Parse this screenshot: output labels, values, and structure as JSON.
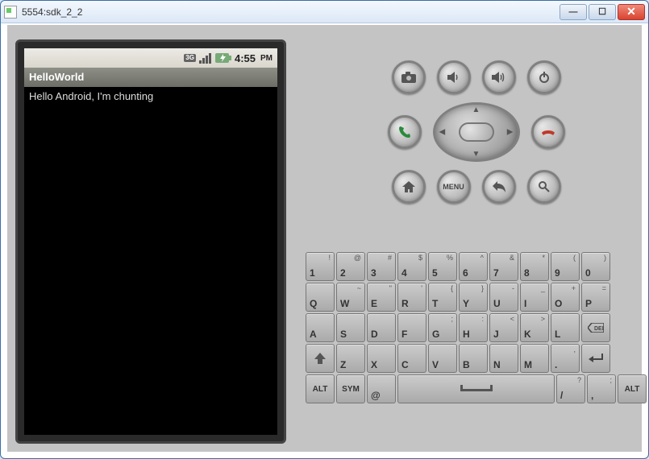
{
  "window": {
    "title": "5554:sdk_2_2"
  },
  "winbtns": {
    "min": "—",
    "max": "☐",
    "close": "✕"
  },
  "statusbar": {
    "threeg_top": "3G",
    "threeg_bot": "↑↓",
    "time": "4:55",
    "ampm": "PM"
  },
  "app": {
    "title": "HelloWorld",
    "body": "Hello Android, I'm chunting"
  },
  "hw": {
    "camera": "camera",
    "voldown": "vol-down",
    "volup": "vol-up",
    "power": "power",
    "call": "call",
    "end": "end-call",
    "home": "home",
    "menu": "MENU",
    "back": "back",
    "search": "search"
  },
  "kb": {
    "row1": [
      {
        "m": "1",
        "a": "!"
      },
      {
        "m": "2",
        "a": "@"
      },
      {
        "m": "3",
        "a": "#"
      },
      {
        "m": "4",
        "a": "$"
      },
      {
        "m": "5",
        "a": "%"
      },
      {
        "m": "6",
        "a": "^"
      },
      {
        "m": "7",
        "a": "&"
      },
      {
        "m": "8",
        "a": "*"
      },
      {
        "m": "9",
        "a": "("
      },
      {
        "m": "0",
        "a": ")"
      }
    ],
    "row2": [
      {
        "m": "Q",
        "a": ""
      },
      {
        "m": "W",
        "a": "~"
      },
      {
        "m": "E",
        "a": "\""
      },
      {
        "m": "R",
        "a": "'"
      },
      {
        "m": "T",
        "a": "{"
      },
      {
        "m": "Y",
        "a": "}"
      },
      {
        "m": "U",
        "a": "-"
      },
      {
        "m": "I",
        "a": "_"
      },
      {
        "m": "O",
        "a": "+"
      },
      {
        "m": "P",
        "a": "="
      }
    ],
    "row3": [
      {
        "m": "A",
        "a": ""
      },
      {
        "m": "S",
        "a": ""
      },
      {
        "m": "D",
        "a": ""
      },
      {
        "m": "F",
        "a": ""
      },
      {
        "m": "G",
        "a": ";"
      },
      {
        "m": "H",
        "a": ":"
      },
      {
        "m": "J",
        "a": "<"
      },
      {
        "m": "K",
        "a": ">"
      },
      {
        "m": "L",
        "a": ""
      }
    ],
    "row3_del": "DEL",
    "row4": [
      {
        "m": "Z",
        "a": ""
      },
      {
        "m": "X",
        "a": ""
      },
      {
        "m": "C",
        "a": ""
      },
      {
        "m": "V",
        "a": ""
      },
      {
        "m": "B",
        "a": ""
      },
      {
        "m": "N",
        "a": ""
      },
      {
        "m": "M",
        "a": ""
      },
      {
        "m": ".",
        "a": ","
      }
    ],
    "row5_alt": "ALT",
    "row5_sym": "SYM",
    "row5_at": {
      "m": "@",
      "a": ""
    },
    "row5_slash": {
      "m": "/",
      "a": "?"
    },
    "row5_comma": {
      "m": ",",
      "a": ";"
    },
    "row5_alt2": "ALT"
  }
}
